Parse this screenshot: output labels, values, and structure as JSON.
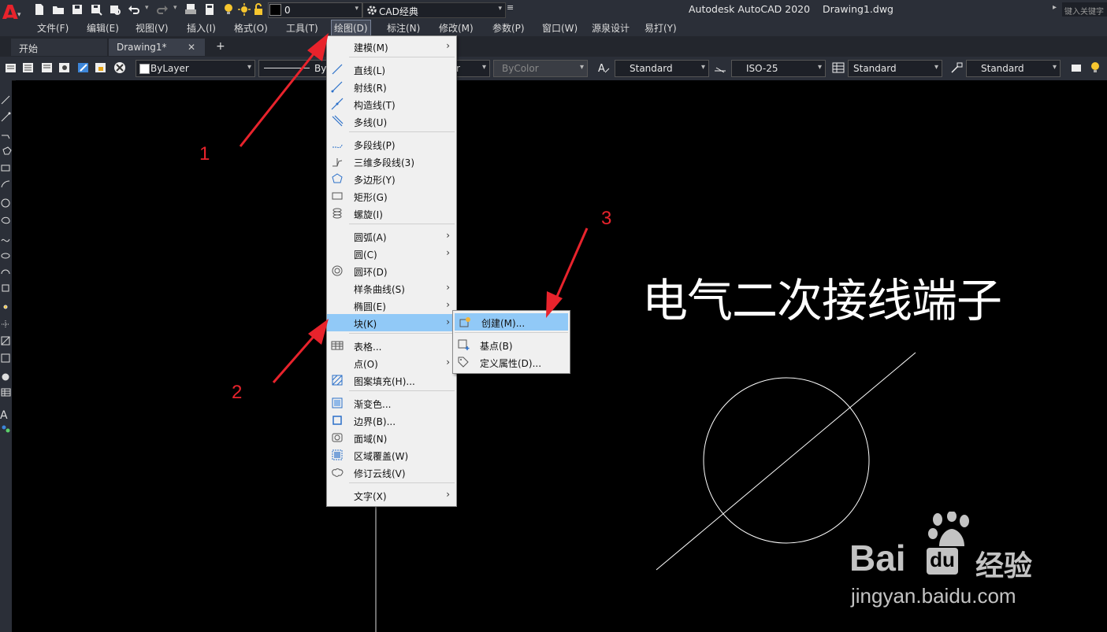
{
  "titlebar": {
    "layer_value": "0",
    "workspace": "CAD经典",
    "app_title": "Autodesk AutoCAD 2020    Drawing1.dwg",
    "search_placeholder": "键入关键字"
  },
  "menubar": {
    "items": [
      "文件(F)",
      "编辑(E)",
      "视图(V)",
      "插入(I)",
      "格式(O)",
      "工具(T)",
      "绘图(D)",
      "标注(N)",
      "修改(M)",
      "参数(P)",
      "窗口(W)",
      "源泉设计",
      "易打(Y)"
    ]
  },
  "tabs": {
    "start": "开始",
    "drawing": "Drawing1*",
    "close": "✕",
    "add": "+"
  },
  "properties": {
    "layer": "ByLayer",
    "linetype": "By",
    "lineweight": "r",
    "plotstyle": "ByColor",
    "text_style": "Standard",
    "dim_style": "ISO-25",
    "table_style": "Standard",
    "mleader_style": "Standard"
  },
  "draw_menu": {
    "items": [
      {
        "label": "建模(M)",
        "submenu": true
      },
      {
        "label": "直线(L)"
      },
      {
        "label": "射线(R)"
      },
      {
        "label": "构造线(T)"
      },
      {
        "label": "多线(U)"
      },
      {
        "label": "多段线(P)"
      },
      {
        "label": "三维多段线(3)"
      },
      {
        "label": "多边形(Y)"
      },
      {
        "label": "矩形(G)"
      },
      {
        "label": "螺旋(I)"
      },
      {
        "label": "圆弧(A)",
        "submenu": true
      },
      {
        "label": "圆(C)",
        "submenu": true
      },
      {
        "label": "圆环(D)"
      },
      {
        "label": "样条曲线(S)",
        "submenu": true
      },
      {
        "label": "椭圆(E)",
        "submenu": true
      },
      {
        "label": "块(K)",
        "submenu": true
      },
      {
        "label": "表格..."
      },
      {
        "label": "点(O)",
        "submenu": true
      },
      {
        "label": "图案填充(H)..."
      },
      {
        "label": "渐变色..."
      },
      {
        "label": "边界(B)..."
      },
      {
        "label": "面域(N)"
      },
      {
        "label": "区域覆盖(W)"
      },
      {
        "label": "修订云线(V)"
      },
      {
        "label": "文字(X)",
        "submenu": true
      }
    ]
  },
  "block_submenu": {
    "items": [
      {
        "label": "创建(M)..."
      },
      {
        "label": "基点(B)"
      },
      {
        "label": "定义属性(D)..."
      }
    ]
  },
  "annotations": {
    "n1": "1",
    "n2": "2",
    "n3": "3",
    "accent": "#e8232c"
  },
  "drawing": {
    "text": "电气二次接线端子"
  },
  "watermark": {
    "brand": "Bai",
    "brand_tail": "经验",
    "du": "du",
    "url": "jingyan.baidu.com"
  }
}
